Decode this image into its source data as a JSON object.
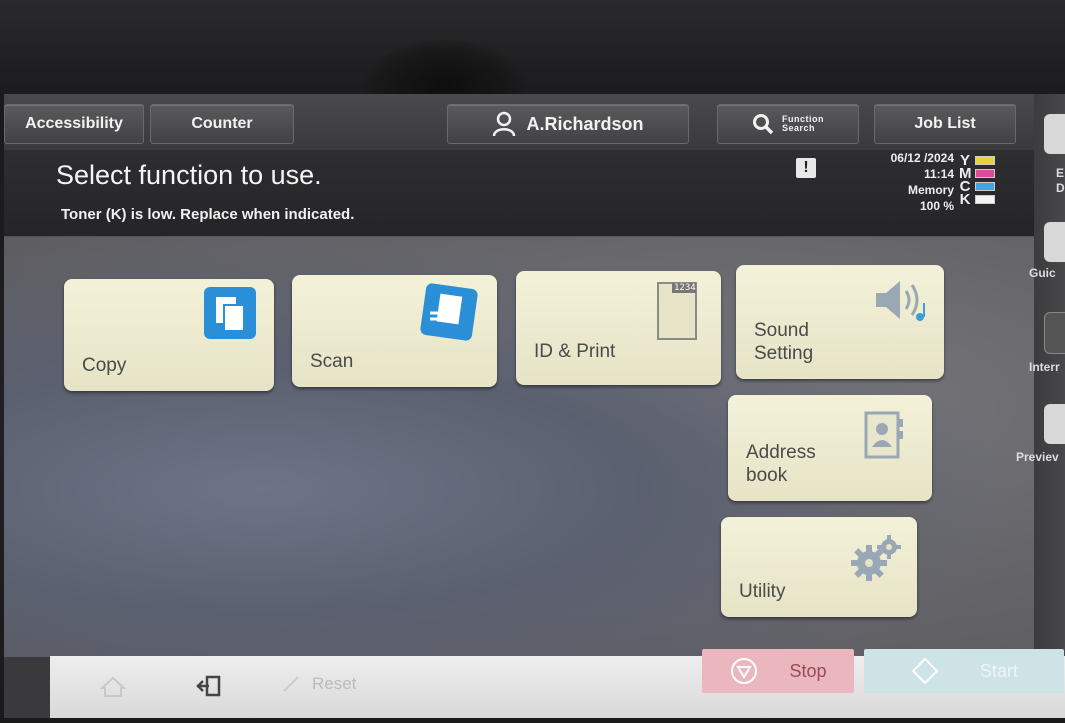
{
  "topbar": {
    "accessibility": "Accessibility",
    "counter": "Counter",
    "user": "A.Richardson",
    "search_line1": "Function",
    "search_line2": "Search",
    "job_list": "Job List"
  },
  "info": {
    "headline": "Select function to use.",
    "message": "Toner (K) is low. Replace when indicated.",
    "warning_mark": "!",
    "date": "06/12 /2024",
    "time": "11:14",
    "memory_label": "Memory",
    "memory_value": "100 %",
    "toner": [
      {
        "letter": "Y",
        "color": "#e6d43a"
      },
      {
        "letter": "M",
        "color": "#d84d95"
      },
      {
        "letter": "C",
        "color": "#3ea6dc"
      },
      {
        "letter": "K",
        "color": "#f4f4f4"
      }
    ]
  },
  "tiles": {
    "copy": "Copy",
    "scan": "Scan",
    "id_print": "ID & Print",
    "id_print_icon_text": "1234",
    "sound_line1": "Sound",
    "sound_line2": "Setting",
    "address_line1": "Address",
    "address_line2": "book",
    "utility": "Utility"
  },
  "side": {
    "item1": "E\nD",
    "guide": "Guic",
    "interrupt": "Interr",
    "preview": "Previev"
  },
  "bottom": {
    "reset": "Reset",
    "stop": "Stop",
    "start": "Start"
  },
  "colors": {
    "tile_bg": "#f0eed4",
    "icon_blue": "#2a8fd6",
    "stop_bg": "#e9b7bd",
    "start_bg": "#cde3e6"
  }
}
